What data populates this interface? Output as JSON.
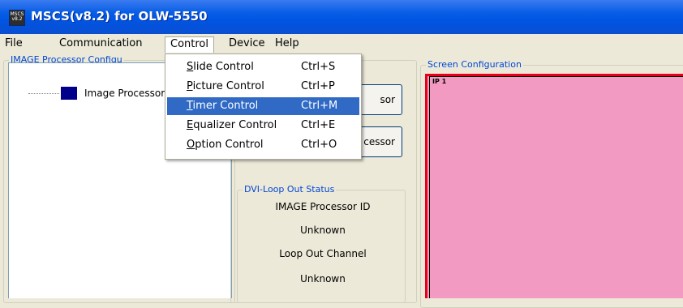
{
  "window": {
    "title": "MSCS(v8.2) for OLW-5550",
    "icon_text": "MSCS v8.2"
  },
  "menubar": {
    "items": [
      {
        "label": "File"
      },
      {
        "label": "Communication"
      },
      {
        "label": "Control"
      },
      {
        "label": "Device"
      },
      {
        "label": "Help"
      }
    ]
  },
  "control_menu": {
    "items": [
      {
        "mnemonic": "S",
        "rest": "lide Control",
        "accel": "Ctrl+S",
        "highlighted": false
      },
      {
        "mnemonic": "P",
        "rest": "icture Control",
        "accel": "Ctrl+P",
        "highlighted": false
      },
      {
        "mnemonic": "T",
        "rest": "imer Control",
        "accel": "Ctrl+M",
        "highlighted": true
      },
      {
        "mnemonic": "E",
        "rest": "qualizer Control",
        "accel": "Ctrl+E",
        "highlighted": false
      },
      {
        "mnemonic": "O",
        "rest": "ption Control",
        "accel": "Ctrl+O",
        "highlighted": false
      }
    ]
  },
  "image_processor_config": {
    "group_label": "IMAGE Processor Configu",
    "tree_item": "Image Processor"
  },
  "buttons": {
    "btn1_label": "sor",
    "btn2_label": "cessor"
  },
  "dvi_status": {
    "group_label": "DVI-Loop Out Status",
    "processor_id_label": "IMAGE Processor ID",
    "processor_id_value": "Unknown",
    "channel_label": "Loop Out Channel",
    "channel_value": "Unknown"
  },
  "screen_config": {
    "group_label": "Screen Configuration",
    "panel_label": "IP 1"
  },
  "colors": {
    "titlebar": "#0054e3",
    "highlight": "#316ac5",
    "screen_fill": "#f29ac1",
    "screen_border": "#e8001a"
  }
}
